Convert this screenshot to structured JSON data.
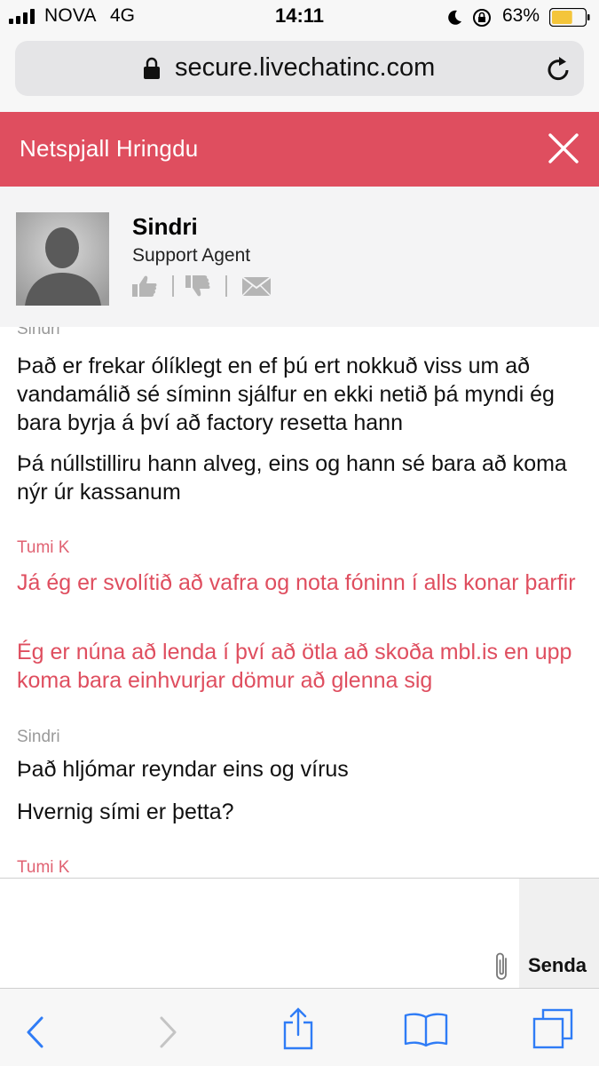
{
  "status_bar": {
    "carrier": "NOVA",
    "network": "4G",
    "time": "14:11",
    "battery_percent": "63%",
    "battery_level": 0.63,
    "battery_color": "#f4c53a",
    "icons": [
      "signal-icon",
      "moon-icon",
      "rotation-lock-icon",
      "battery-icon"
    ]
  },
  "browser": {
    "url": "secure.livechatinc.com",
    "icons": [
      "lock-icon",
      "reload-icon"
    ]
  },
  "chat": {
    "title": "Netspjall Hringdu",
    "header_color": "#df4e5f",
    "agent": {
      "name": "Sindri",
      "role": "Support Agent"
    },
    "messages": [
      {
        "author": "Sindri",
        "from_visitor": false,
        "lines": [
          "Það er frekar ólíklegt en ef þú ert nokkuð viss um að vandamálið sé síminn sjálfur en ekki netið þá myndi ég bara byrja á því að factory resetta hann",
          "Þá núllstilliru hann alveg, eins og hann sé bara að koma nýr úr kassanum"
        ]
      },
      {
        "author": "Tumi K",
        "from_visitor": true,
        "lines": [
          "Já ég er svolítið að vafra og nota fóninn í alls konar þarfir",
          "Ég er núna að lenda í því að ötla að skoða mbl.is en upp koma bara einhvurjar dömur að glenna sig"
        ]
      },
      {
        "author": "Sindri",
        "from_visitor": false,
        "lines": [
          "Það hljómar reyndar eins og vírus",
          "Hvernig sími er þetta?"
        ]
      },
      {
        "author": "Tumi K",
        "from_visitor": true,
        "lines": []
      }
    ]
  },
  "composer": {
    "input_value": "",
    "send_label": "Senda"
  },
  "toolbar": {
    "icons": [
      "back-icon",
      "forward-icon",
      "share-icon",
      "bookmarks-icon",
      "tabs-icon"
    ]
  }
}
